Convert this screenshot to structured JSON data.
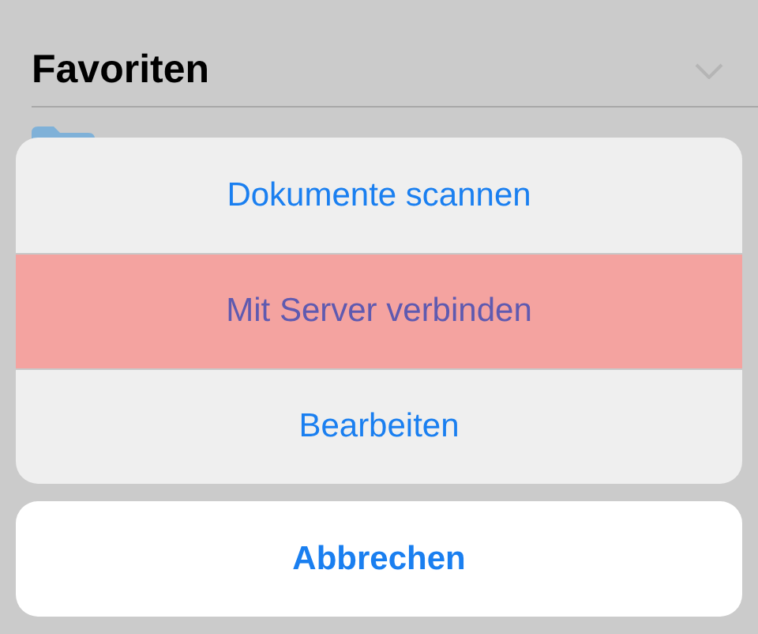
{
  "section": {
    "title": "Favoriten",
    "expanded": true
  },
  "action_sheet": {
    "actions": [
      {
        "label": "Dokumente scannen",
        "selected": false
      },
      {
        "label": "Mit Server verbinden",
        "selected": true
      },
      {
        "label": "Bearbeiten",
        "selected": false
      }
    ],
    "cancel": "Abbrechen"
  }
}
